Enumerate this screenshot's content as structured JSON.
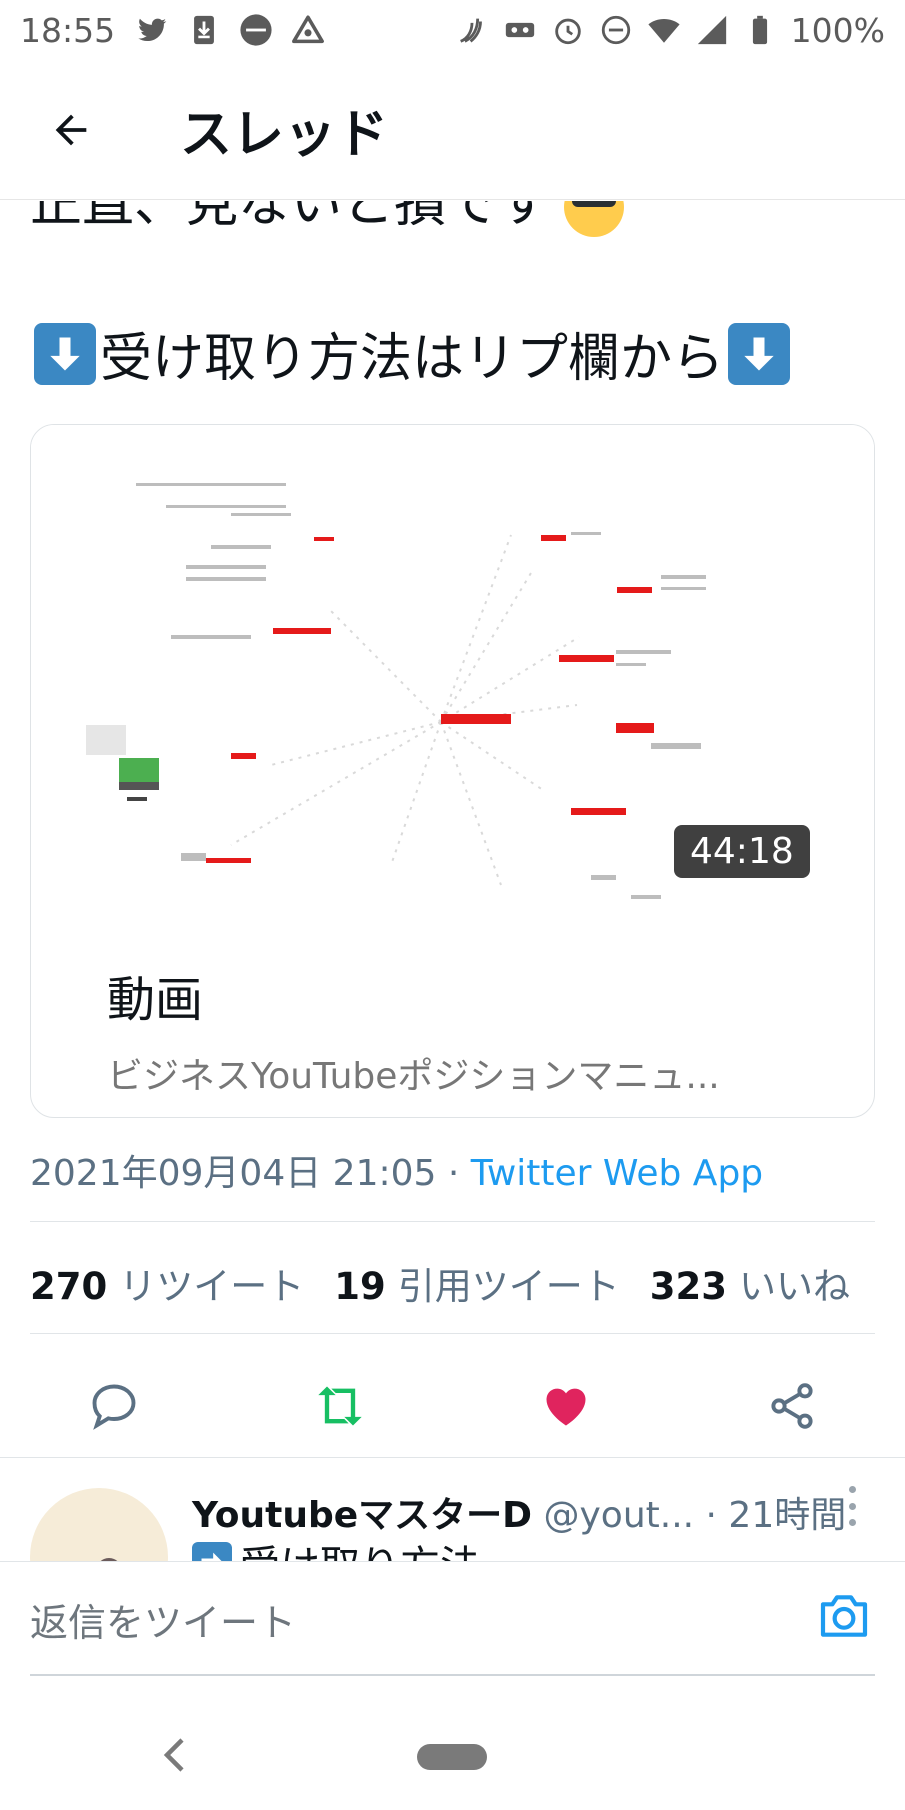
{
  "status_bar": {
    "time": "18:55",
    "battery": "100%",
    "left_icons": [
      "twitter-icon",
      "download-icon",
      "aquos-icon",
      "triangle-icon"
    ],
    "right_icons": [
      "nfc-icon",
      "vr-icon",
      "alarm-icon",
      "dnd-icon",
      "wifi-icon",
      "signal-icon",
      "battery-icon"
    ]
  },
  "top_bar": {
    "back_icon": "arrow-left-icon",
    "title": "スレッド"
  },
  "tweet": {
    "partial_line": "正直、見ないと損です",
    "line": "受け取り方法はリプ欄から"
  },
  "card": {
    "duration": "44:18",
    "title": "動画",
    "description": "ビジネスYouTubeポジションマニュ..."
  },
  "meta": {
    "timestamp": "2021年09月04日 21:05",
    "separator": " · ",
    "source": "Twitter Web App"
  },
  "stats": {
    "retweets_count": "270",
    "retweets_label": "リツイート",
    "quotes_count": "19",
    "quotes_label": "引用ツイート",
    "likes_count": "323",
    "likes_label": "いいね"
  },
  "actions": {
    "reply_icon": "reply-icon",
    "retweet_icon": "retweet-icon",
    "like_icon": "heart-icon",
    "share_icon": "share-icon",
    "colors": {
      "retweet": "#17bf63",
      "like": "#e0245e",
      "default": "#5b7083"
    }
  },
  "reply": {
    "display_name": "YoutubeマスターD",
    "handle": "@yout...",
    "time": "· 21時間",
    "body": "受け取り方法"
  },
  "compose": {
    "placeholder": "返信をツイート",
    "camera_icon": "camera-icon"
  },
  "nav": {
    "back_icon": "nav-back-icon",
    "home_icon": "nav-home-pill"
  }
}
